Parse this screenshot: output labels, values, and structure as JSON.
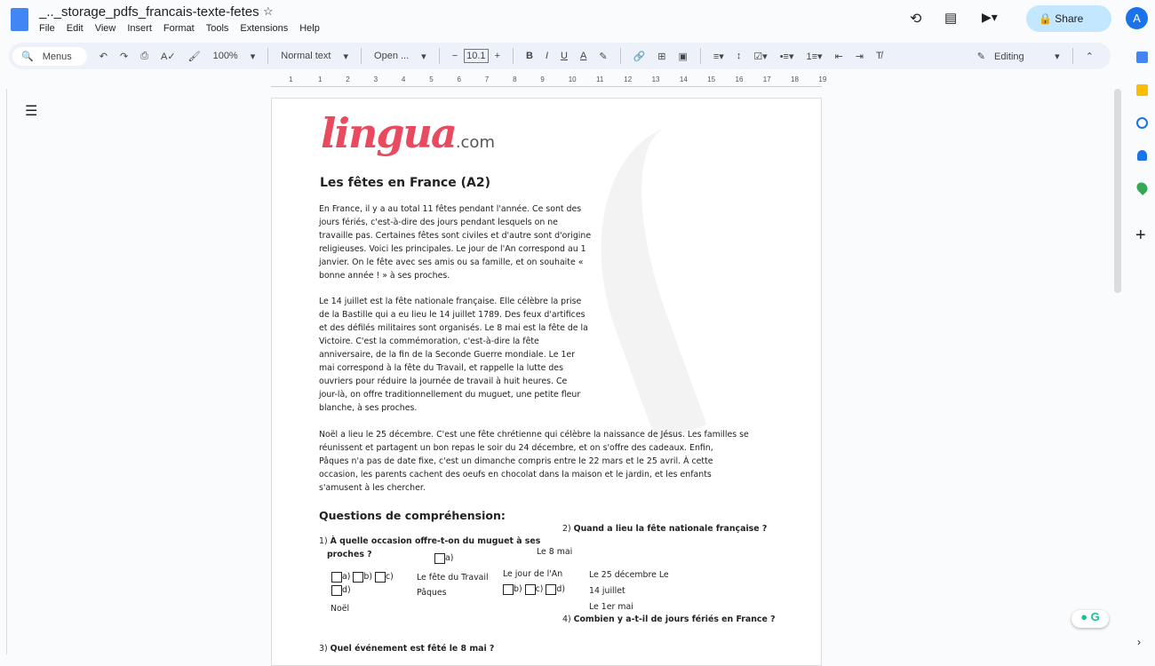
{
  "app": {
    "title": "_.._storage_pdfs_francais-texte-fetes",
    "menu": [
      "File",
      "Edit",
      "View",
      "Insert",
      "Format",
      "Tools",
      "Extensions",
      "Help"
    ],
    "share": "Share",
    "avatar": "A"
  },
  "toolbar": {
    "search": "Menus",
    "zoom": "100%",
    "style": "Normal text",
    "font": "Open ...",
    "size": "10.1",
    "mode": "Editing"
  },
  "ruler": [
    "1",
    "1",
    "2",
    "3",
    "4",
    "5",
    "6",
    "7",
    "8",
    "9",
    "10",
    "11",
    "12",
    "13",
    "14",
    "15",
    "16",
    "17",
    "18",
    "19"
  ],
  "doc": {
    "logo": "lingua.com",
    "heading": "Les fêtes en France (A2)",
    "p1": [
      "En France, il y a au total 11 fêtes pendant l'année. Ce sont des",
      "jours fériés, c'est-à-dire des jours pendant lesquels on ne",
      "travaille pas. Certaines fêtes sont civiles et d'autre sont d'origine",
      "religieuses. Voici les principales. Le jour de l'An correspond au 1",
      "janvier. On le fête avec ses amis ou sa famille, et on souhaite «",
      "bonne année ! » à ses proches."
    ],
    "p2": [
      "Le 14 juillet est la fête nationale française. Elle célèbre la prise",
      "de la Bastille qui a eu lieu le 14 juillet 1789. Des feux d'artifices",
      "et des défilés militaires sont organisés. Le 8 mai est la fête de la",
      "Victoire. C'est la commémoration, c'est-à-dire la fête",
      "anniversaire, de la fin de la Seconde Guerre mondiale. Le 1er",
      "mai correspond à la fête du Travail, et rappelle la lutte des",
      "ouvriers pour réduire la journée de travail à huit heures. Ce",
      "jour-là, on offre traditionnellement du muguet, une petite fleur",
      "blanche, à ses proches."
    ],
    "p3": [
      "Noël a lieu le 25 décembre. C'est une fête chrétienne qui célèbre la naissance de Jésus. Les familles se",
      "réunissent et partagent un bon repas le soir du 24 décembre, et on s'offre des cadeaux. Enfin,",
      "Pâques n'a pas de date fixe, c'est un dimanche compris entre le 22 mars et le 25 avril. À cette",
      "occasion, les parents cachent des oeufs en chocolat dans la maison et le jardin, et les enfants",
      "s'amusent à les chercher."
    ],
    "questions_heading": "Questions de compréhension:",
    "q1_num": "1)",
    "q1a": "À quelle occasion offre-t-on du muguet à ses",
    "q1b": "proches ?",
    "q2_num": "2)",
    "q2": "Quand a lieu la fête nationale française ?",
    "q3_num": "3)",
    "q3": "Quel événement est fêté le 8 mai ?",
    "q4_num": "4)",
    "q4": "Combien y a-t-il de jours fériés en France ?",
    "opt": {
      "a": "a)",
      "b": "b)",
      "c": "c)",
      "d": "d)"
    },
    "q1_answers": [
      "Le fête du Travail",
      "Pâques",
      "Noël"
    ],
    "q2_answers": [
      "Le 8 mai",
      "Le jour de l'An",
      "Le 25 décembre Le",
      "14 juillet",
      "Le 1er mai"
    ]
  }
}
